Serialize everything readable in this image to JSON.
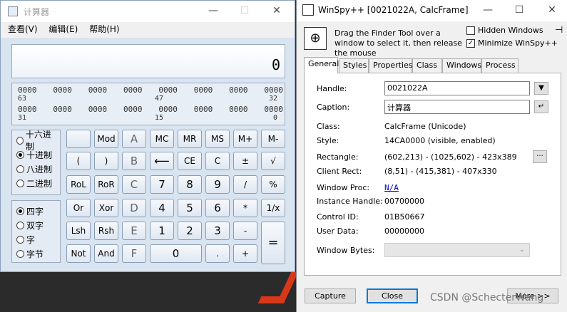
{
  "calc": {
    "title": "计算器",
    "menu": [
      "查看(V)",
      "编辑(E)",
      "帮助(H)"
    ],
    "display": "0",
    "bits": {
      "row1": [
        "0000",
        "0000",
        "0000",
        "0000",
        "0000",
        "0000",
        "0000",
        "0000"
      ],
      "row1_nums": [
        "63",
        "47",
        "32"
      ],
      "row2": [
        "0000",
        "0000",
        "0000",
        "0000",
        "0000",
        "0000",
        "0000",
        "0000"
      ],
      "row2_nums": [
        "31",
        "15",
        "0"
      ]
    },
    "base_radios": [
      "十六进制",
      "十进制",
      "八进制",
      "二进制"
    ],
    "base_selected": 1,
    "word_radios": [
      "四字",
      "双字",
      "字",
      "字节"
    ],
    "word_selected": 0,
    "keys": {
      "blank": "",
      "mod": "Mod",
      "a": "A",
      "mc": "MC",
      "mr": "MR",
      "ms": "MS",
      "mplus": "M+",
      "mminus": "M-",
      "lparen": "(",
      "rparen": ")",
      "b": "B",
      "back": "⟵",
      "ce": "CE",
      "c": "C",
      "pm": "±",
      "sqrt": "√",
      "rol": "RoL",
      "ror": "RoR",
      "cc": "C",
      "n7": "7",
      "n8": "8",
      "n9": "9",
      "div": "/",
      "pct": "%",
      "or": "Or",
      "xor": "Xor",
      "d": "D",
      "n4": "4",
      "n5": "5",
      "n6": "6",
      "mul": "*",
      "recip": "1/x",
      "lsh": "Lsh",
      "rsh": "Rsh",
      "e": "E",
      "n1": "1",
      "n2": "2",
      "n3": "3",
      "sub": "-",
      "eq": "=",
      "not": "Not",
      "and": "And",
      "f": "F",
      "n0": "0",
      "dot": ".",
      "add": "+"
    }
  },
  "spy": {
    "title": "WinSpy++ [0021022A, CalcFrame]",
    "hint": "Drag the Finder Tool over a window to select it, then release the mouse",
    "hidden_windows": "Hidden Windows",
    "minimize": "Minimize WinSpy++",
    "tabs": [
      "General",
      "Styles",
      "Properties",
      "Class",
      "Windows",
      "Process"
    ],
    "fields": {
      "handle_label": "Handle:",
      "handle": "0021022A",
      "caption_label": "Caption:",
      "caption": "计算器",
      "class_label": "Class:",
      "class": "CalcFrame  (Unicode)",
      "style_label": "Style:",
      "style": "14CA0000  (visible, enabled)",
      "rect_label": "Rectangle:",
      "rect": "(602,213) - (1025,602)  -  423x389",
      "client_label": "Client Rect:",
      "client": "(8,51) - (415,381)  -  407x330",
      "proc_label": "Window Proc:",
      "proc": "N/A",
      "inst_label": "Instance Handle:",
      "inst": "00700000",
      "ctrl_label": "Control ID:",
      "ctrl": "01B50667",
      "user_label": "User Data:",
      "user": "00000000",
      "bytes_label": "Window Bytes:"
    },
    "buttons": {
      "capture": "Capture",
      "close": "Close",
      "more": "More >>"
    },
    "watermark": "CSDN @SchecterWang"
  }
}
